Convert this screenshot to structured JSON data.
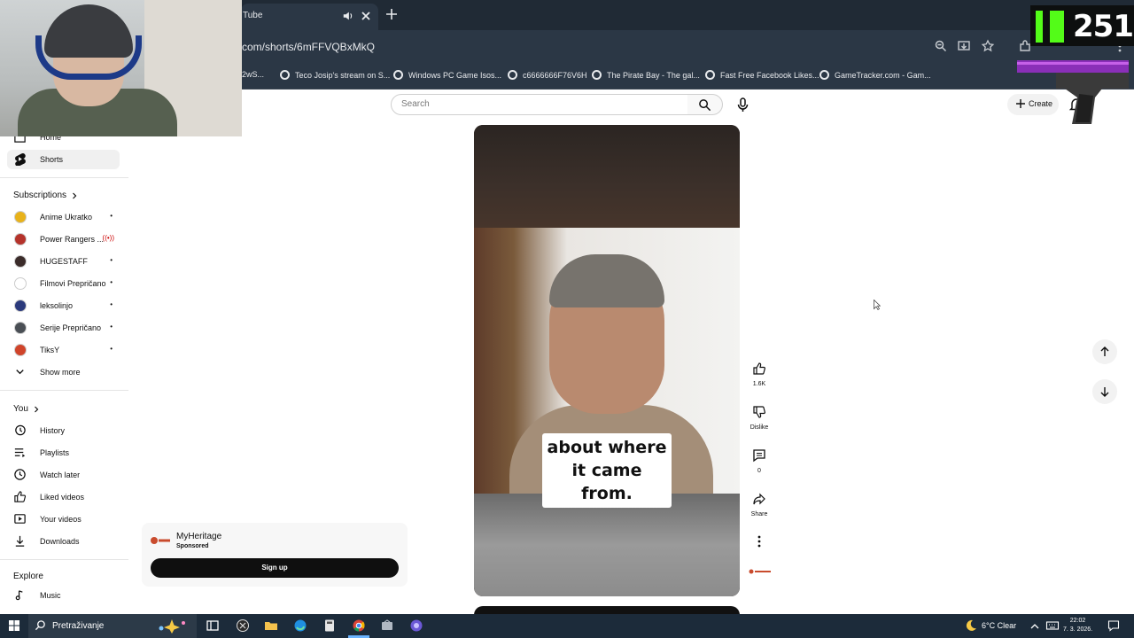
{
  "browser": {
    "tab_title": "Tube",
    "url": "com/shorts/6mFFVQBxMkQ",
    "bookmarks": [
      "2wS...",
      "Teco Josip's stream on S...",
      "Windows PC Game Isos...",
      "c6666666F76V6H",
      "The Pirate Bay - The gal...",
      "Fast Free Facebook Likes...",
      "GameTracker.com - Gam..."
    ]
  },
  "overlay": {
    "kick_count": "251"
  },
  "header": {
    "search_placeholder": "Search",
    "create_label": "Create"
  },
  "sidebar": {
    "home": "Home",
    "shorts": "Shorts",
    "subscriptions_heading": "Subscriptions",
    "subscriptions": [
      {
        "name": "Anime Ukratko",
        "mark": "•",
        "color": "#e8b21a"
      },
      {
        "name": "Power Rangers ...",
        "mark": "((•))",
        "color": "#b5332b"
      },
      {
        "name": "HUGESTAFF",
        "mark": "•",
        "color": "#3b2c2a"
      },
      {
        "name": "Filmovi Prepričano",
        "mark": "•",
        "color": "#ffffff"
      },
      {
        "name": "leksolinjo",
        "mark": "•",
        "color": "#2b3a7c"
      },
      {
        "name": "Serije Prepričano",
        "mark": "•",
        "color": "#4a4f55"
      },
      {
        "name": "TiksY",
        "mark": "•",
        "color": "#d0442a"
      }
    ],
    "show_more": "Show more",
    "you_heading": "You",
    "you_items": [
      "History",
      "Playlists",
      "Watch later",
      "Liked videos",
      "Your videos",
      "Downloads"
    ],
    "explore_heading": "Explore",
    "explore_items": [
      "Music"
    ]
  },
  "video": {
    "caption_line1": "about where",
    "caption_line2": "it came from."
  },
  "actions": {
    "likes": "1.6K",
    "dislike": "Dislike",
    "comments": "0",
    "share": "Share",
    "channel_mark": "MyHeritage"
  },
  "ad": {
    "advertiser": "MyHeritage",
    "sponsored": "Sponsored",
    "button": "Sign up",
    "logo_text": "MyHeritage"
  },
  "taskbar": {
    "search": "Pretraživanje",
    "weather": "6°C  Clear",
    "time": "22:02",
    "date": "7. 3. 2026."
  }
}
